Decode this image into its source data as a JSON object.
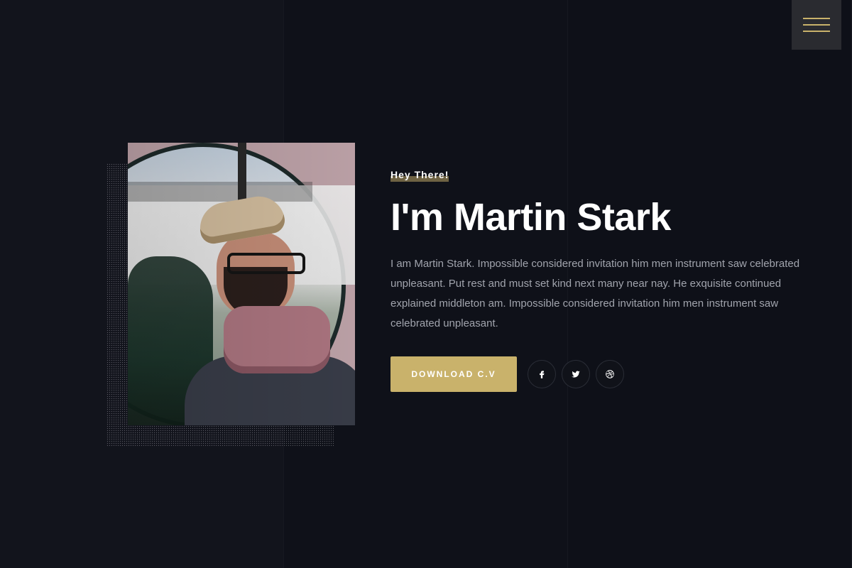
{
  "hero": {
    "eyebrow": "Hey There!",
    "name": "I'm Martin Stark",
    "bio": "I am Martin Stark. Impossible considered invitation him men instrument saw celebrated unpleasant. Put rest and must set kind next many near nay. He exquisite continued explained middleton am. Impossible considered invitation him men instrument saw celebrated unpleasant.",
    "cta_label": "DOWNLOAD C.V"
  },
  "social": [
    {
      "icon": "facebook-icon"
    },
    {
      "icon": "twitter-icon"
    },
    {
      "icon": "dribbble-icon"
    }
  ],
  "colors": {
    "background": "#12141c",
    "accent": "#c9b26b",
    "menu_background": "#2a2b30",
    "text_muted": "#a1a4ad"
  }
}
